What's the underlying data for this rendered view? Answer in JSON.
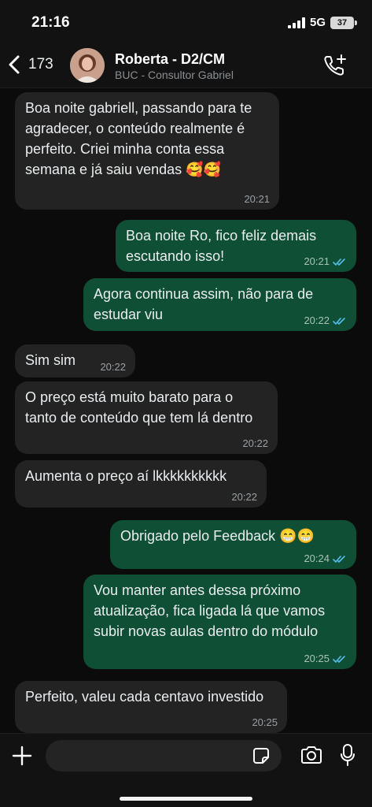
{
  "status_bar": {
    "time": "21:16",
    "network": "5G",
    "battery": "37"
  },
  "header": {
    "back_count": "173",
    "contact_name": "Roberta - D2/CM",
    "contact_subtitle": "BUC - Consultor Gabriel",
    "icons": {
      "back": "chevron-left-icon",
      "call": "add-call-icon"
    }
  },
  "messages": [
    {
      "direction": "in",
      "text": "Boa noite gabriell, passando para te agradecer, o conteúdo realmente é perfeito. Criei minha conta essa semana e já saiu vendas 🥰🥰",
      "time": "20:21"
    },
    {
      "direction": "out",
      "text": "Boa noite Ro, fico feliz demais escutando isso!",
      "time": "20:21",
      "read": true
    },
    {
      "direction": "out",
      "text": "Agora continua assim, não para de estudar viu",
      "time": "20:22",
      "read": true
    },
    {
      "direction": "in",
      "text": "Sim sim",
      "time": "20:22"
    },
    {
      "direction": "in",
      "text": "O preço está muito barato para o tanto de conteúdo que tem lá dentro",
      "time": "20:22"
    },
    {
      "direction": "in",
      "text": "Aumenta o preço aí lkkkkkkkkkk",
      "time": "20:22"
    },
    {
      "direction": "out",
      "text": "Obrigado pelo Feedback 😁😁",
      "time": "20:24",
      "read": true
    },
    {
      "direction": "out",
      "text": "Vou manter antes dessa próximo atualização, fica ligada lá que vamos subir novas aulas dentro do módulo",
      "time": "20:25",
      "read": true
    },
    {
      "direction": "in",
      "text": "Perfeito, valeu cada centavo investido",
      "time": "20:25"
    }
  ],
  "input_bar": {
    "placeholder": "",
    "icons": [
      "plus-icon",
      "sticker-icon",
      "camera-icon",
      "microphone-icon"
    ]
  },
  "colors": {
    "incoming_bubble": "#232323",
    "outgoing_bubble": "#0f4f35",
    "read_ticks": "#53bdeb",
    "background": "#0b0b0b"
  }
}
